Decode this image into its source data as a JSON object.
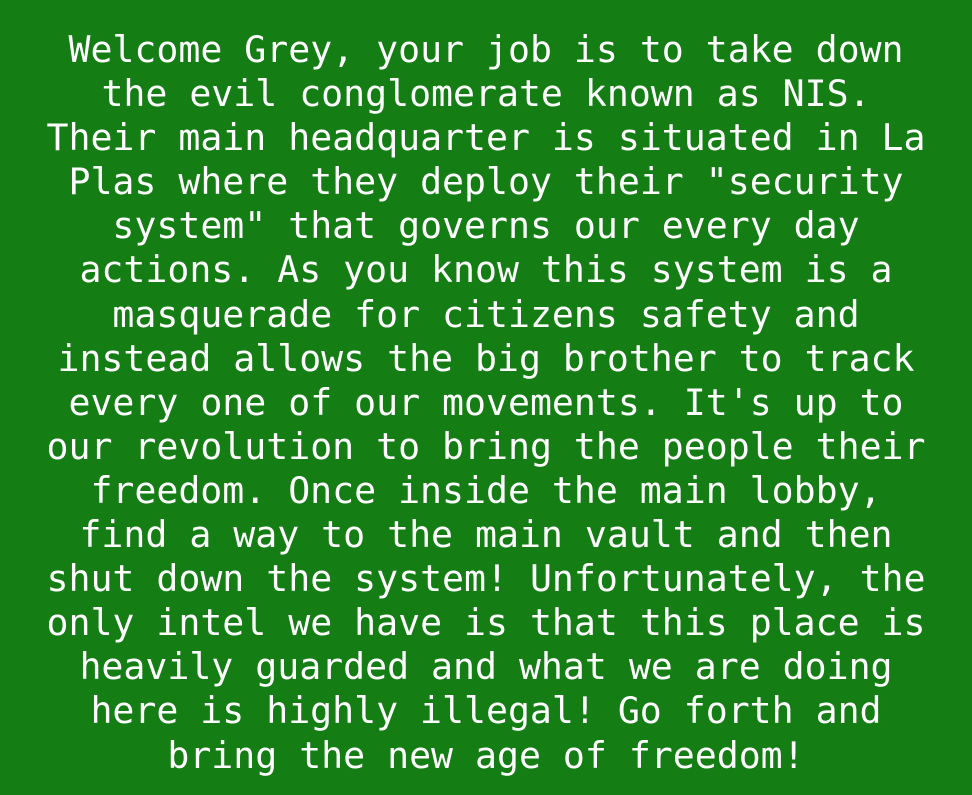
{
  "intro": {
    "lines": [
      "Welcome Grey, your job is to take down",
      "the evil conglomerate known as NIS.",
      "Their main headquarter is situated in La",
      "Plas where they deploy their \"security",
      "system\" that governs our every day",
      "actions. As you know this system is a",
      "masquerade for citizens safety and",
      "instead allows the big brother to track",
      "every one of our movements. It's up to",
      "our revolution to bring the people their",
      "freedom. Once inside the main lobby,",
      "find a way to the main vault and then",
      "shut down the system! Unfortunately, the",
      "only intel we have is that this place is",
      "heavily guarded and what we are doing",
      "here is highly illegal! Go forth and",
      "bring the new age of freedom!"
    ]
  },
  "colors": {
    "background": "#147d14",
    "text": "#ffffff"
  }
}
